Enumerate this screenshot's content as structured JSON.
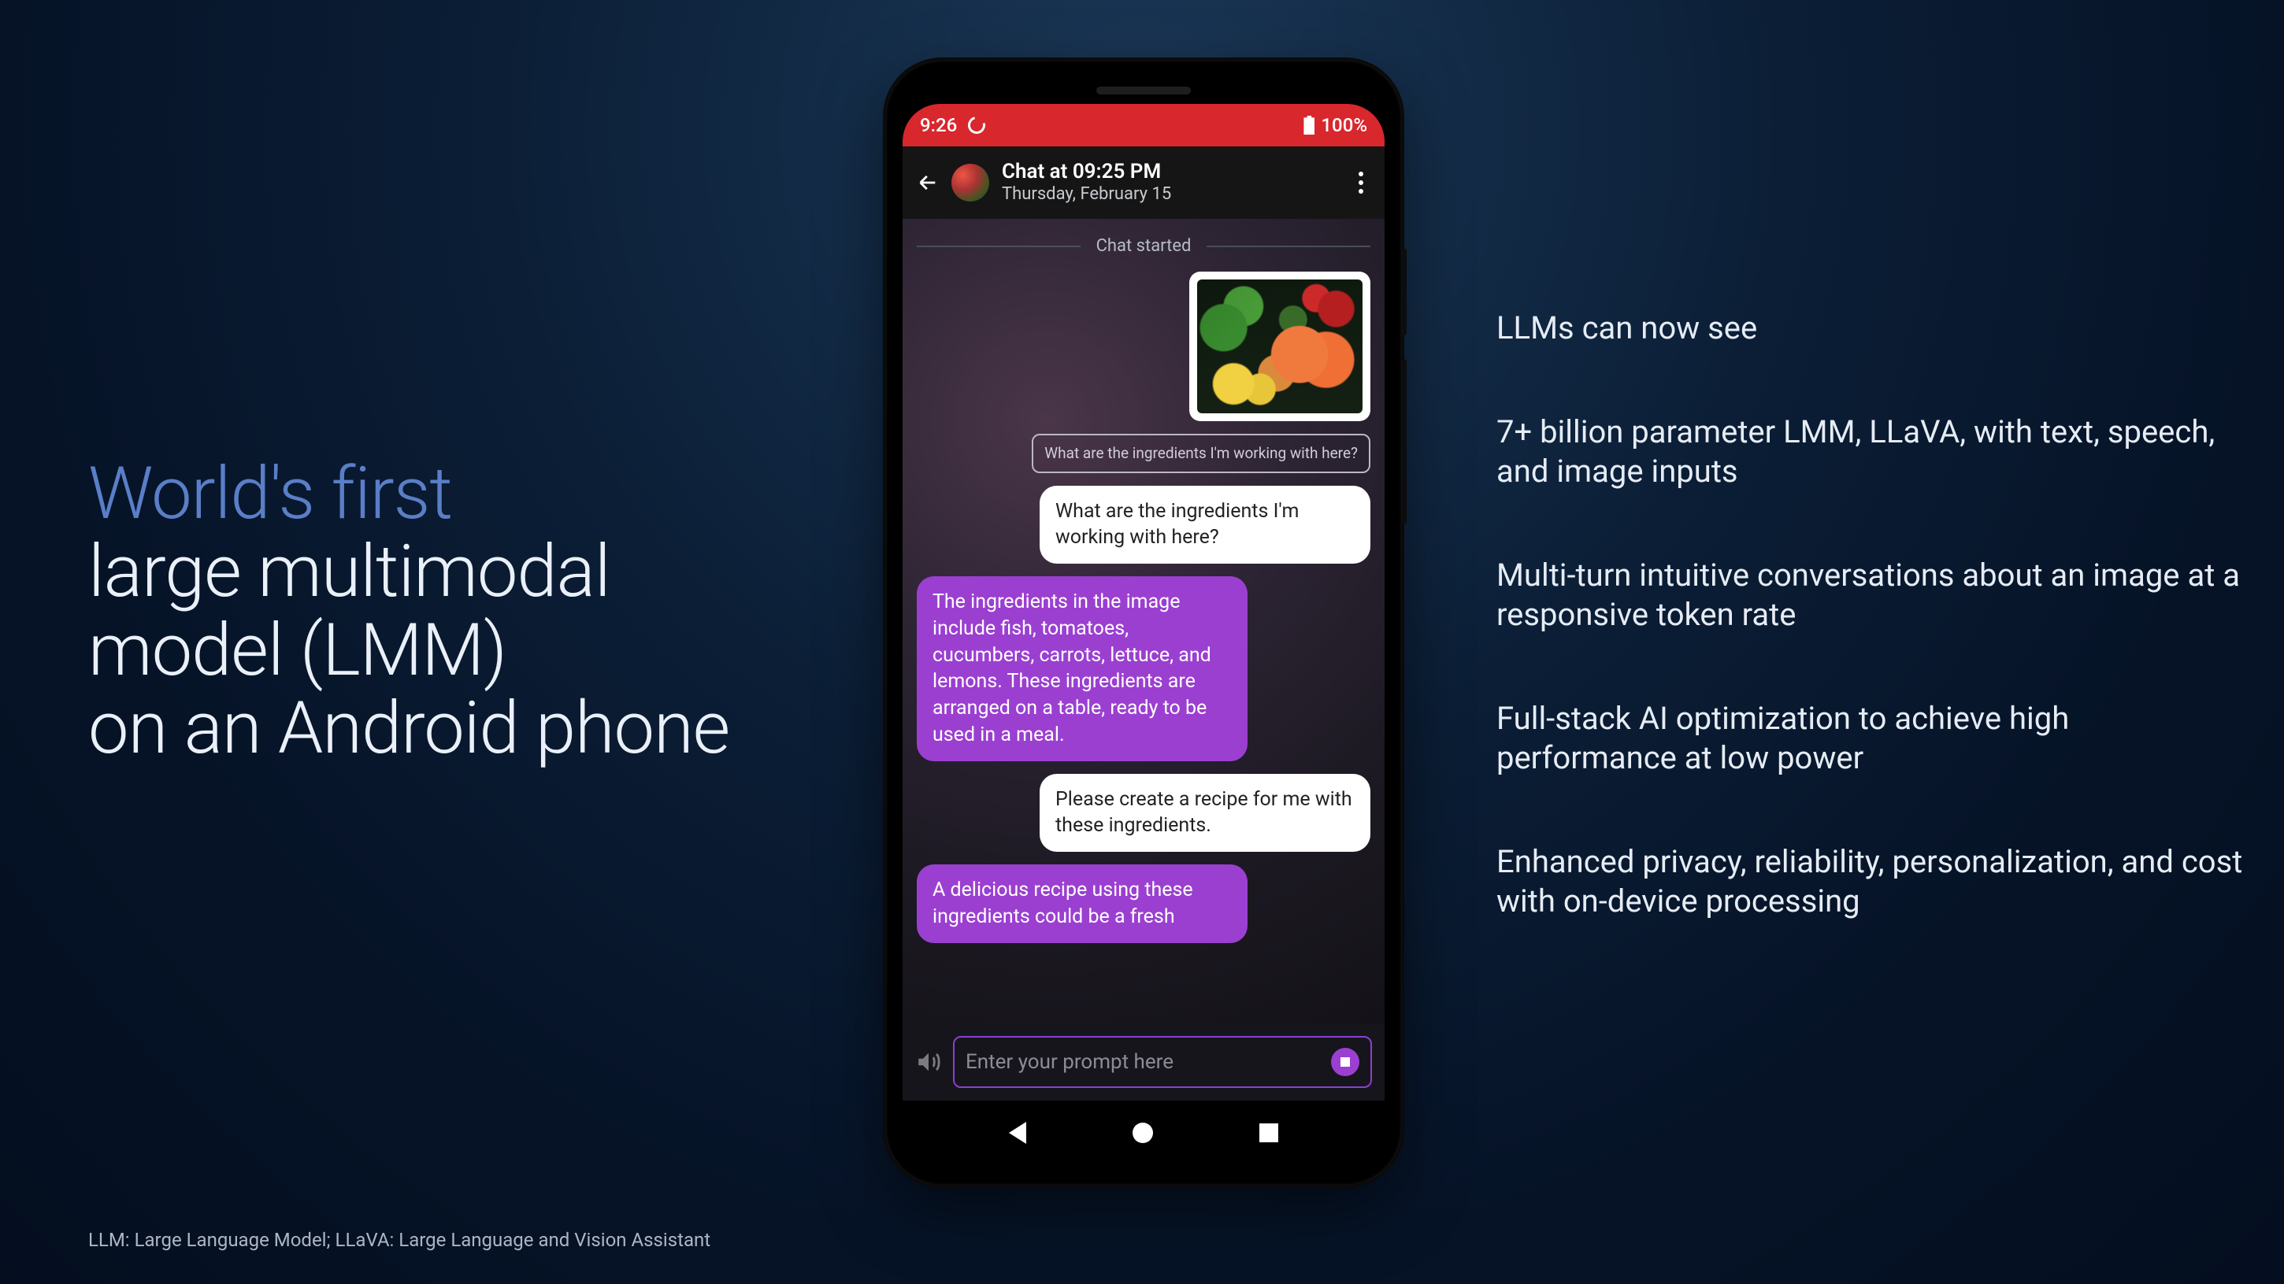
{
  "title": {
    "accent": "World's first",
    "line2": "large multimodal",
    "line3": "model (LMM)",
    "line4": "on an Android phone"
  },
  "bullets": [
    "LLMs can now see",
    "7+ billion parameter LMM, LLaVA, with text, speech, and image inputs",
    "Multi-turn intuitive conversations about an image at a responsive token rate",
    "Full-stack AI optimization to achieve high performance at low power",
    "Enhanced privacy, reliability, personalization, and cost with on-device processing"
  ],
  "footnote": "LLM: Large Language Model; LLaVA: Large Language and Vision Assistant",
  "phone": {
    "status": {
      "time": "9:26",
      "battery": "100%"
    },
    "header": {
      "title": "Chat at 09:25 PM",
      "subtitle": "Thursday, February 15"
    },
    "divider_label": "Chat started",
    "quoted_prompt": "What are the ingredients I'm working with here?",
    "messages": {
      "user1": "What are the ingredients I'm working with here?",
      "assistant1": " The ingredients in the image include fish, tomatoes, cucumbers, carrots, lettuce, and lemons. These ingredients are arranged on a table, ready to be used in a meal.",
      "user2": "Please create a recipe for me with these ingredients.",
      "assistant2": " A delicious recipe using these ingredients could be a fresh"
    },
    "input_placeholder": "Enter your prompt here"
  }
}
